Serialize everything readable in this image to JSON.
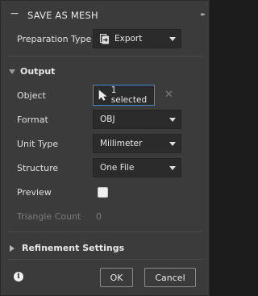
{
  "dialog": {
    "title": "SAVE AS MESH",
    "collapse_glyph": "−",
    "pin_glyph": "▸▸"
  },
  "preparation_type": {
    "label": "Preparation Type",
    "value": "Export",
    "icon": "export-icon"
  },
  "output": {
    "header": "Output",
    "object": {
      "label": "Object",
      "value": "1 selected",
      "icon": "cursor-arrow-icon",
      "clear_glyph": "✕"
    },
    "format": {
      "label": "Format",
      "value": "OBJ"
    },
    "unit_type": {
      "label": "Unit Type",
      "value": "Millimeter"
    },
    "structure": {
      "label": "Structure",
      "value": "One File"
    },
    "preview": {
      "label": "Preview",
      "checked": false
    },
    "triangle_count": {
      "label": "Triangle Count",
      "value": "0"
    }
  },
  "refinement": {
    "header": "Refinement Settings"
  },
  "footer": {
    "info_glyph": "i",
    "ok_label": "OK",
    "cancel_label": "Cancel"
  },
  "colors": {
    "panel": "#3b3b3b",
    "field": "#2b2b2b",
    "accent_border": "#3f8bd1",
    "disabled_text": "#7c7c7c"
  }
}
